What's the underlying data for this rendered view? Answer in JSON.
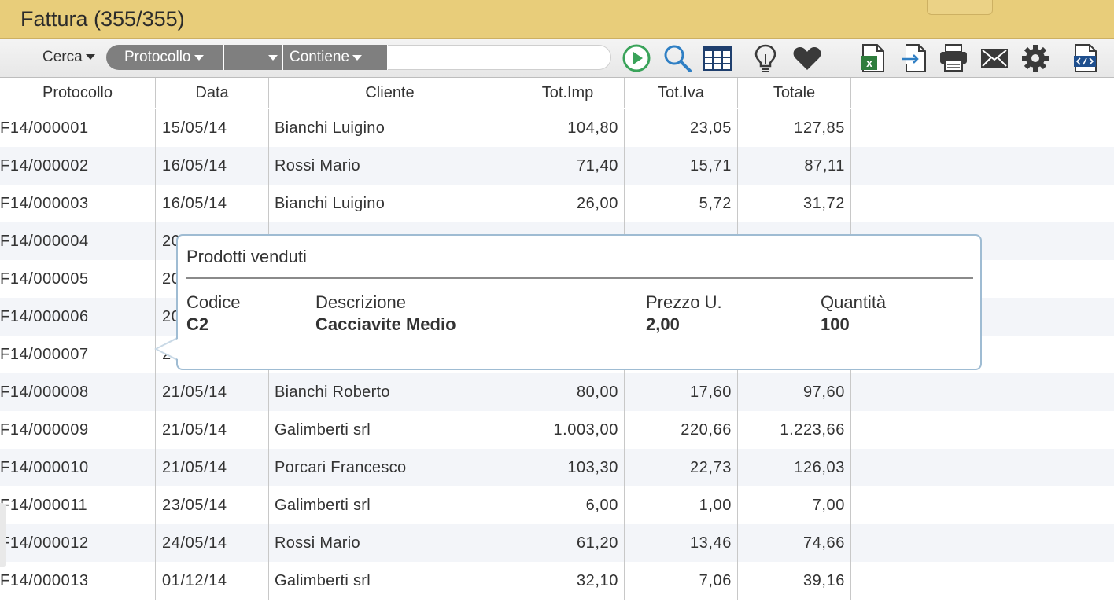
{
  "window": {
    "title": "Fattura (355/355)"
  },
  "toolbar": {
    "cerca_label": "Cerca",
    "field_label": "Protocollo",
    "operator_label": "",
    "condition_label": "Contiene",
    "search_value": "",
    "icons": [
      "play-icon",
      "search-icon",
      "table-icon",
      "lightbulb-icon",
      "heart-icon",
      "excel-icon",
      "import-icon",
      "print-icon",
      "mail-icon",
      "gear-icon",
      "code-icon"
    ]
  },
  "table": {
    "headers": [
      "Protocollo",
      "Data",
      "Cliente",
      "Tot.Imp",
      "Tot.Iva",
      "Totale"
    ],
    "rows": [
      [
        "F14/000001",
        "15/05/14",
        "Bianchi Luigino",
        "104,80",
        "23,05",
        "127,85"
      ],
      [
        "F14/000002",
        "16/05/14",
        "Rossi Mario",
        "71,40",
        "15,71",
        "87,11"
      ],
      [
        "F14/000003",
        "16/05/14",
        "Bianchi Luigino",
        "26,00",
        "5,72",
        "31,72"
      ],
      [
        "F14/000004",
        "20",
        "",
        "",
        "",
        ""
      ],
      [
        "F14/000005",
        "20",
        "",
        "",
        "",
        ""
      ],
      [
        "F14/000006",
        "20",
        "",
        "",
        "",
        ""
      ],
      [
        "F14/000007",
        "2",
        "",
        "",
        "",
        ""
      ],
      [
        "F14/000008",
        "21/05/14",
        "Bianchi Roberto",
        "80,00",
        "17,60",
        "97,60"
      ],
      [
        "F14/000009",
        "21/05/14",
        "Galimberti srl",
        "1.003,00",
        "220,66",
        "1.223,66"
      ],
      [
        "F14/000010",
        "21/05/14",
        "Porcari Francesco",
        "103,30",
        "22,73",
        "126,03"
      ],
      [
        "F14/000011",
        "23/05/14",
        "Galimberti srl",
        "6,00",
        "1,00",
        "7,00"
      ],
      [
        "F14/000012",
        "24/05/14",
        "Rossi Mario",
        "61,20",
        "13,46",
        "74,66"
      ],
      [
        "F14/000013",
        "01/12/14",
        "Galimberti srl",
        "32,10",
        "7,06",
        "39,16"
      ]
    ]
  },
  "popup": {
    "title": "Prodotti venduti",
    "columns": [
      {
        "header": "Codice",
        "value": "C2"
      },
      {
        "header": "Descrizione",
        "value": "Cacciavite Medio"
      },
      {
        "header": "Prezzo U.",
        "value": "2,00"
      },
      {
        "header": "Quantità",
        "value": "100"
      }
    ]
  },
  "colors": {
    "titlebar": "#e8cd7a",
    "filter_segment": "#7f7f7f",
    "play_green": "#3aa35a",
    "popup_border": "#9fbcd3"
  }
}
